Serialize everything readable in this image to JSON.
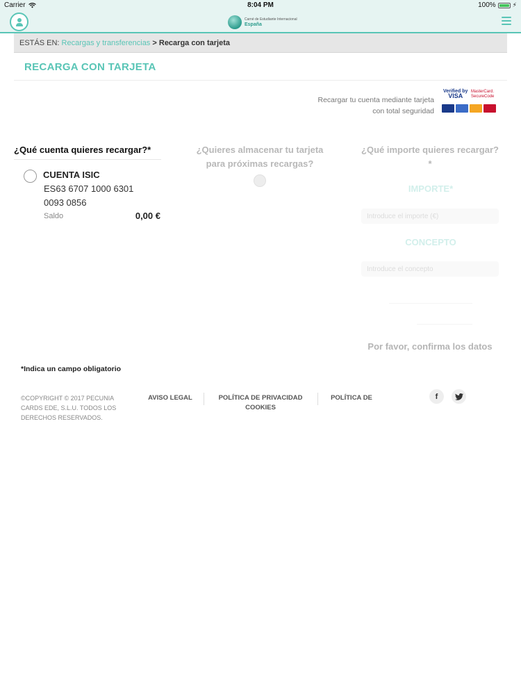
{
  "status_bar": {
    "carrier": "Carrier",
    "time": "8:04 PM",
    "battery": "100%"
  },
  "nav": {
    "logo_line1": "Carné de Estudiante Internacional",
    "logo_line2": "España"
  },
  "breadcrumb": {
    "prefix": "ESTÁS EN:",
    "link": "Recargas y transferencias",
    "separator": ">",
    "current": "Recarga con tarjeta"
  },
  "page_title": "RECARGA CON TARJETA",
  "secure": {
    "text_line1": "Recargar tu cuenta mediante tarjeta",
    "text_line2": "con total seguridad",
    "verified_line1": "Verified by",
    "verified_line2": "VISA",
    "mastercard_line1": "MasterCard.",
    "mastercard_line2": "SecureCode",
    "brand_colors": [
      "#1a3a8a",
      "#3b6cc7",
      "#f5a623",
      "#c8102e"
    ]
  },
  "account_column": {
    "title": "¿Qué cuenta quieres recargar?*",
    "account_name": "CUENTA ISIC",
    "iban_line1": "ES63 6707 1000 6301",
    "iban_line2": "0093 0856",
    "balance_label": "Saldo",
    "balance_value": "0,00 €"
  },
  "store_column": {
    "title_line1": "¿Quieres almacenar tu tarjeta",
    "title_line2": "para próximas recargas?"
  },
  "amount_column": {
    "title_line1": "¿Qué importe quieres recargar?",
    "title_line2": "*",
    "amount_label": "IMPORTE*",
    "amount_placeholder": "Introduce el importe (€)",
    "concept_label": "CONCEPTO",
    "concept_placeholder": "Introduce el concepto",
    "confirm_text": "Por favor, confirma los datos"
  },
  "required_note": "*Indica un campo obligatorio",
  "footer": {
    "copyright_line1": "©COPYRIGHT © 2017 PECUNIA",
    "copyright_line2": "CARDS EDE, S.L.U. TODOS LOS",
    "copyright_line3": "DERECHOS RESERVADOS.",
    "legal": "AVISO LEGAL",
    "privacy_line1": "POLÍTICA DE PRIVACIDAD",
    "privacy_line2": "COOKIES",
    "cookies": "POLÍTICA DE",
    "facebook_glyph": "f",
    "twitter_icon": "twitter-icon"
  },
  "colors": {
    "accent": "#59c5b6",
    "header_bg": "#e6f4f2",
    "breadcrumb_bg": "#e6e6e6"
  }
}
